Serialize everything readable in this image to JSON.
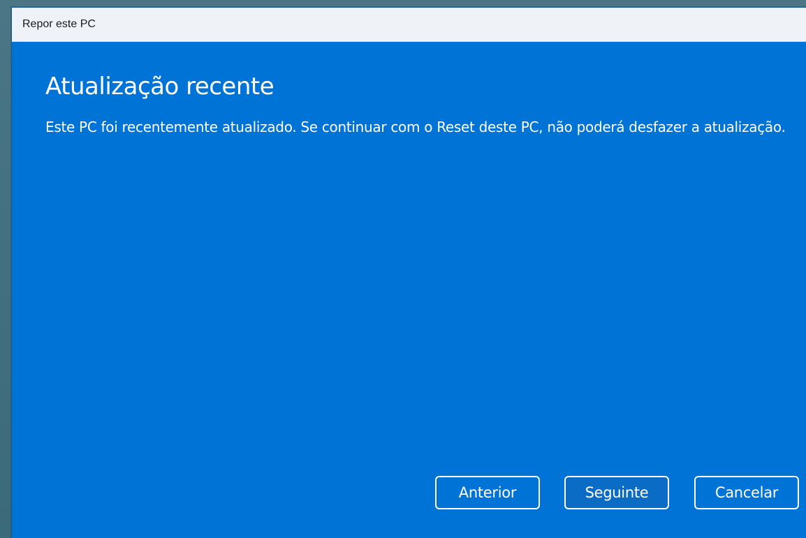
{
  "window": {
    "title": "Repor este PC"
  },
  "page": {
    "heading": "Atualização recente",
    "description": "Este PC foi recentemente atualizado. Se continuar com o Reset deste PC, não poderá desfazer a atualização."
  },
  "buttons": {
    "previous": "Anterior",
    "next": "Seguinte",
    "cancel": "Cancelar"
  },
  "colors": {
    "dialog_background": "#0073d6",
    "titlebar_background": "#eff3f8",
    "text": "#ffffff"
  }
}
